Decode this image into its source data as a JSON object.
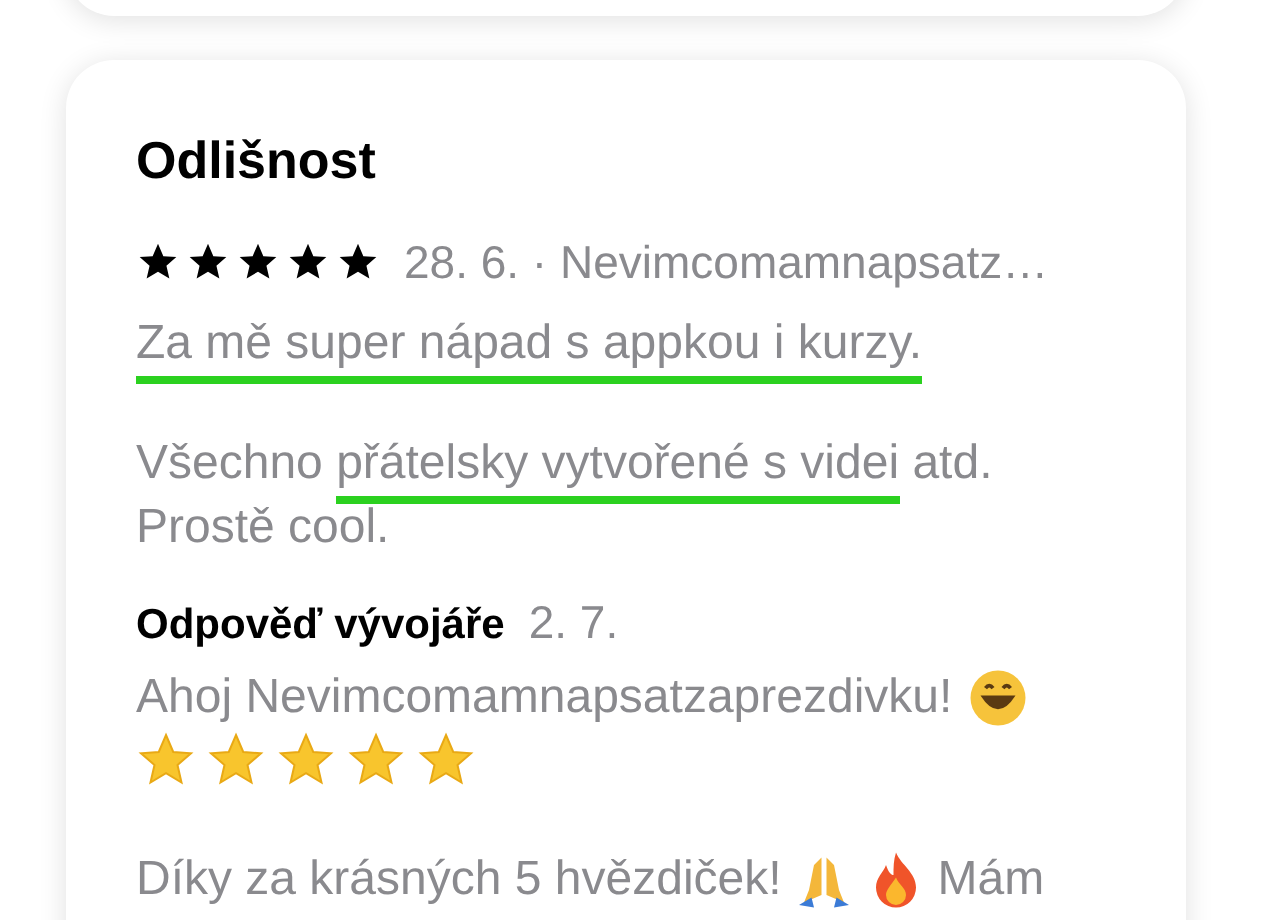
{
  "review": {
    "title": "Odlišnost",
    "stars": 5,
    "meta": "28. 6. · Nevimcomamnapsatz…",
    "paragraphs": [
      {
        "segments": [
          {
            "text": "Za mě super nápad s appkou i kurzy.",
            "marked": true
          }
        ]
      },
      {
        "segments": [
          {
            "text": "Všechno ",
            "marked": false
          },
          {
            "text": "přátelsky vytvořené s videi",
            "marked": true
          },
          {
            "text": " atd. Prostě cool.",
            "marked": false
          }
        ]
      }
    ]
  },
  "developer_response": {
    "label": "Odpověď vývojáře",
    "date": "2. 7.",
    "greeting": "Ahoj Nevimcomamnapsatzaprezdivku!",
    "thanks": "Díky za krásných 5 hvězdiček!",
    "continuation": "Mám"
  }
}
